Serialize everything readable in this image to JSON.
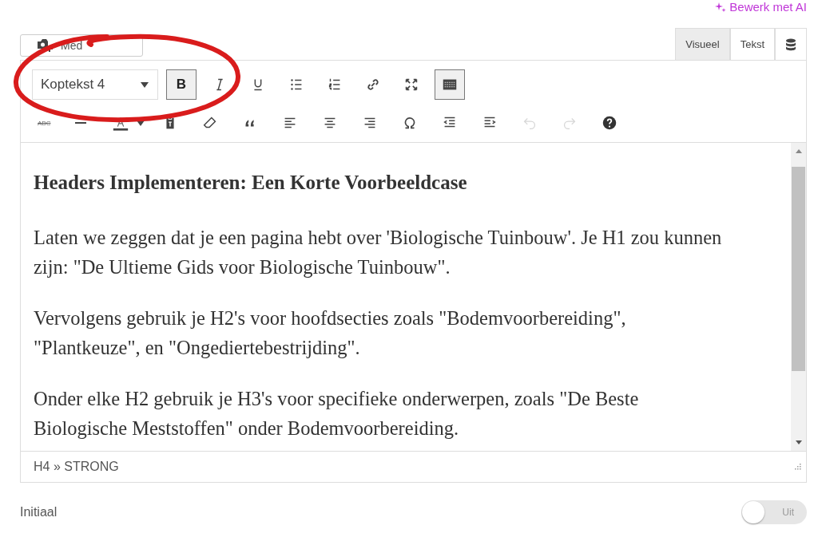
{
  "ai_link": "Bewerk met AI",
  "media_button": {
    "label": "Med"
  },
  "tabs": [
    {
      "label": "Visueel",
      "selected": true
    },
    {
      "label": "Tekst",
      "selected": false
    }
  ],
  "format_select": {
    "value": "Koptekst 4"
  },
  "toolbar_row_1": [
    {
      "kind": "bold",
      "glyph": "B",
      "active": true,
      "disabled": false
    },
    {
      "kind": "italic",
      "active": false,
      "disabled": false
    },
    {
      "kind": "underline",
      "active": false,
      "disabled": false
    },
    {
      "kind": "bullets",
      "active": false,
      "disabled": false
    },
    {
      "kind": "numbers",
      "active": false,
      "disabled": false
    },
    {
      "kind": "link",
      "active": false,
      "disabled": false
    },
    {
      "kind": "fullscreen",
      "active": false,
      "disabled": false
    },
    {
      "kind": "toolbar",
      "active": true,
      "disabled": false
    }
  ],
  "toolbar_row_2": [
    {
      "kind": "strike",
      "glyph": "ABC",
      "active": false,
      "disabled": false
    },
    {
      "kind": "hr",
      "active": false,
      "disabled": false
    },
    {
      "kind": "color",
      "active": false,
      "disabled": false
    },
    {
      "kind": "paste",
      "active": false,
      "disabled": false
    },
    {
      "kind": "eraser",
      "active": false,
      "disabled": false
    },
    {
      "kind": "quote",
      "active": false,
      "disabled": false
    },
    {
      "kind": "alignleft",
      "active": false,
      "disabled": false
    },
    {
      "kind": "aligncenter",
      "active": false,
      "disabled": false
    },
    {
      "kind": "alignright",
      "active": false,
      "disabled": false
    },
    {
      "kind": "omega",
      "active": false,
      "disabled": false
    },
    {
      "kind": "outdent",
      "active": false,
      "disabled": false
    },
    {
      "kind": "indent",
      "active": false,
      "disabled": false
    },
    {
      "kind": "undo",
      "active": false,
      "disabled": true
    },
    {
      "kind": "redo",
      "active": false,
      "disabled": true
    },
    {
      "kind": "help",
      "active": false,
      "disabled": false
    }
  ],
  "content": {
    "heading": "Headers Implementeren: Een Korte Voorbeeldcase",
    "paragraphs": [
      "Laten we zeggen dat je een pagina hebt over 'Biologische Tuinbouw'. Je H1 zou kunnen zijn: \"De Ultieme Gids voor Biologische Tuinbouw\".",
      "Vervolgens gebruik je H2's voor hoofdsecties zoals \"Bodemvoorbereiding\", \"Plantkeuze\", en \"Ongediertebestrijding\".",
      "Onder elke H2 gebruik je H3's voor specifieke onderwerpen, zoals \"De Beste Biologische Meststoffen\" onder Bodemvoorbereiding."
    ]
  },
  "status_path": "H4 » STRONG",
  "setting": {
    "label": "Initiaal",
    "on": false,
    "state_label": "Uit"
  }
}
